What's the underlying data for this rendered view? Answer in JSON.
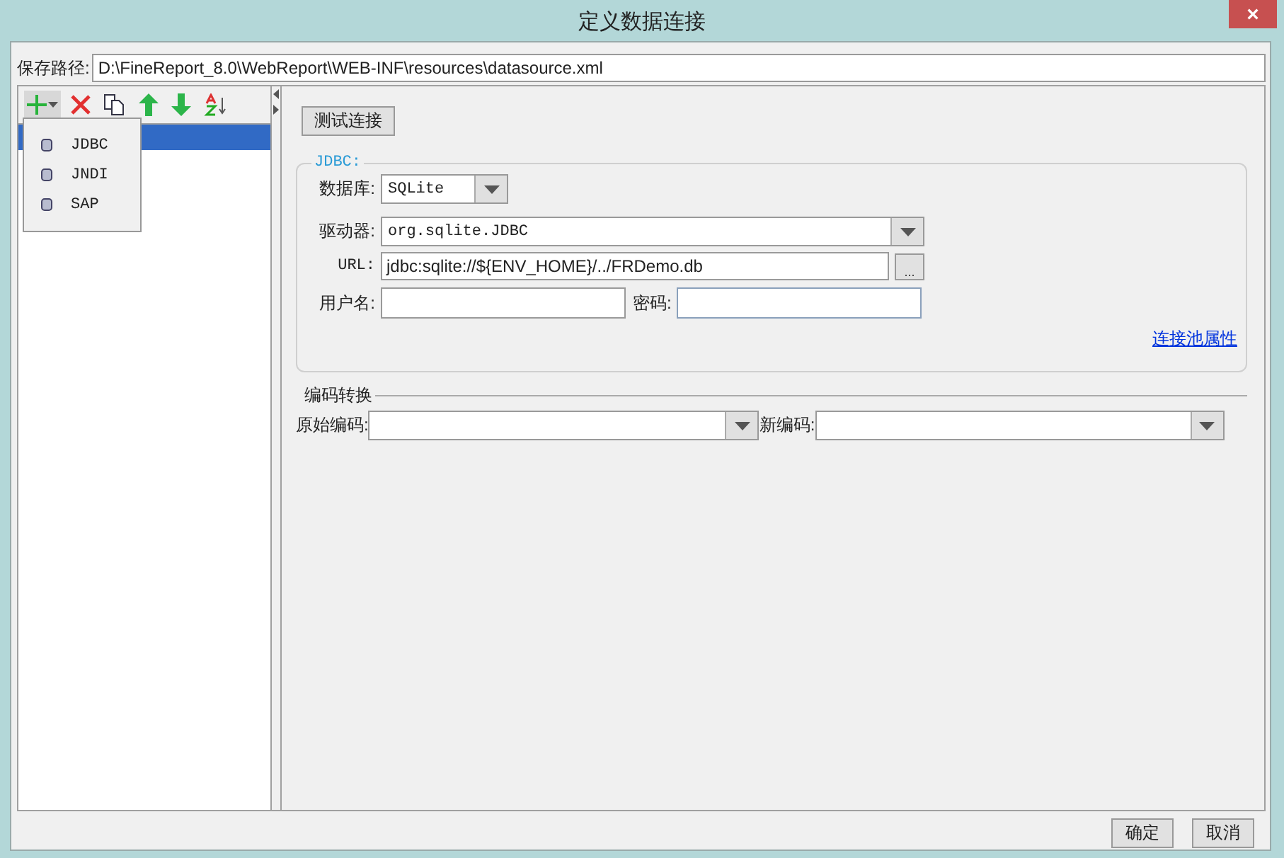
{
  "window": {
    "title": "定义数据连接",
    "close": "×"
  },
  "save_path": {
    "label": "保存路径:",
    "value": "D:\\FineReport_8.0\\WebReport\\WEB-INF\\resources\\datasource.xml"
  },
  "connections": [
    {
      "selected": true
    }
  ],
  "add_menu": [
    {
      "label": "JDBC"
    },
    {
      "label": "JNDI"
    },
    {
      "label": "SAP"
    }
  ],
  "test_button": "测试连接",
  "jdbc": {
    "title": "JDBC:",
    "database": {
      "label": "数据库:",
      "value": "SQLite"
    },
    "driver": {
      "label": "驱动器:",
      "value": "org.sqlite.JDBC"
    },
    "url": {
      "label": "URL:",
      "value": "jdbc:sqlite://${ENV_HOME}/../FRDemo.db",
      "browse": "..."
    },
    "username": {
      "label": "用户名:"
    },
    "password": {
      "label": "密码:"
    },
    "pool_link": "连接池属性"
  },
  "encoding": {
    "title": "编码转换",
    "original": {
      "label": "原始编码:"
    },
    "new": {
      "label": "新编码:"
    }
  },
  "buttons": [
    "确定",
    "取消"
  ]
}
